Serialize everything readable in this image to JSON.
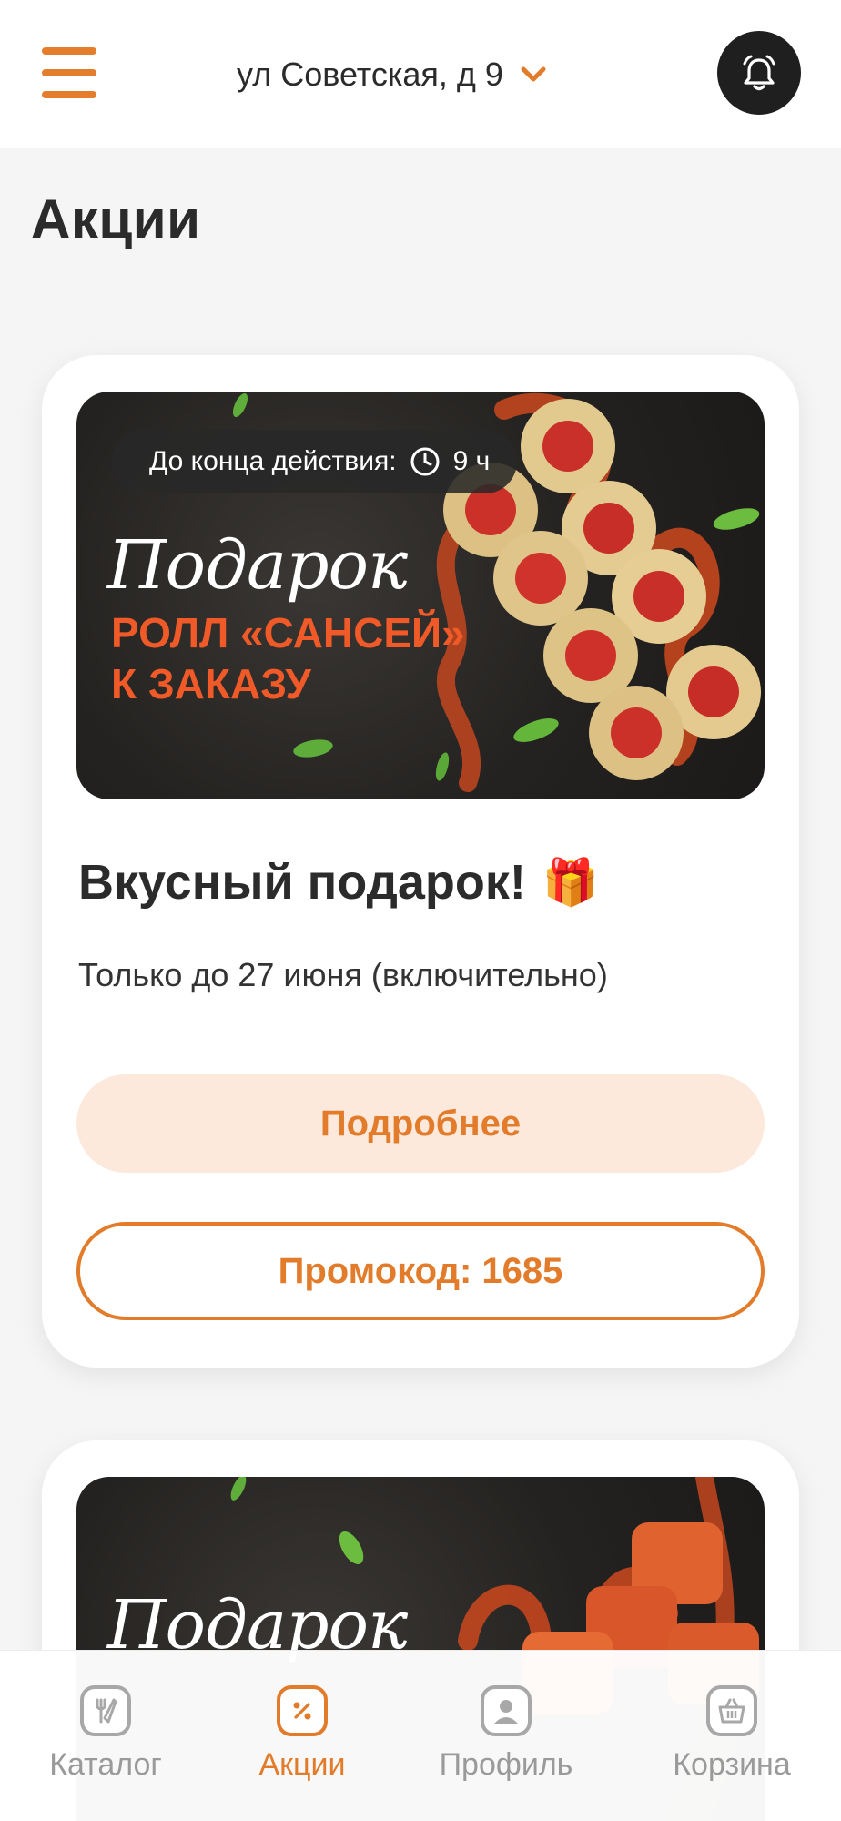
{
  "header": {
    "address": "ул Советская, д 9",
    "colors": {
      "accent": "#e27b2a",
      "bell_bg": "#1f1f1f"
    },
    "icons": {
      "menu": "hamburger-icon",
      "address_toggle": "chevron-down-icon",
      "notifications": "alarm-bell-icon"
    }
  },
  "page": {
    "title": "Акции"
  },
  "promos": [
    {
      "timer_label": "До конца действия:",
      "timer_value": "9 ч",
      "banner_script": "Подарок",
      "banner_line_1": "РОЛЛ «САНСЕЙ»",
      "banner_line_2": "К ЗАКАЗУ",
      "title": "Вкусный подарок!",
      "title_emoji": "🎁",
      "subtitle": "Только до 27 июня (включительно)",
      "details_label": "Подробнее",
      "promo_label": "Промокод: 1685"
    },
    {
      "banner_script": "Подарок"
    }
  ],
  "bottom_nav": {
    "items": [
      {
        "label": "Каталог",
        "icon": "fork-knife-icon",
        "active": false
      },
      {
        "label": "Акции",
        "icon": "percent-icon",
        "active": true
      },
      {
        "label": "Профиль",
        "icon": "user-icon",
        "active": false
      },
      {
        "label": "Корзина",
        "icon": "basket-icon",
        "active": false
      }
    ]
  }
}
